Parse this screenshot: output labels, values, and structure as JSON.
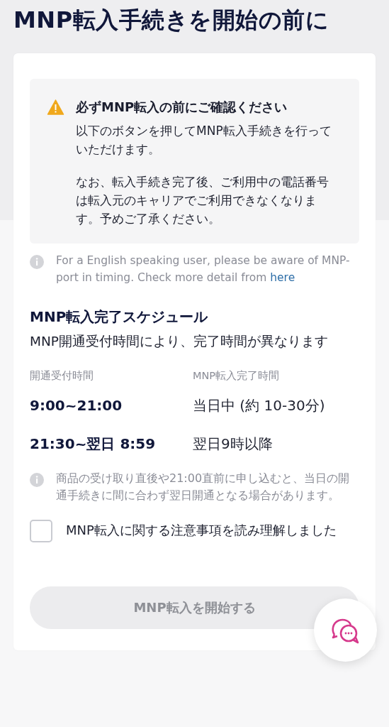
{
  "title": "MNP転入手続きを開始の前に",
  "warning": {
    "heading": "必ずMNP転入の前にご確認ください",
    "paragraphs": [
      "以下のボタンを押してMNP転入手続きを行っていただけます。",
      "なお、転入手続き完了後、ご利用中の電話番号は転入元のキャリアでご利用できなくなります。予めご了承ください。"
    ]
  },
  "english_note": {
    "text": "For a English speaking user, please be aware of MNP-port in timing. Check more detail from ",
    "link": "here"
  },
  "schedule": {
    "heading": "MNP転入完了スケジュール",
    "description": "MNP開通受付時間により、完了時間が異なります",
    "columns": [
      "開通受付時間",
      "MNP転入完了時間"
    ],
    "rows": [
      {
        "reception": "9:00~21:00",
        "completion": "当日中 (約 10-30分)"
      },
      {
        "reception": "21:30~翌日 8:59",
        "completion": "翌日9時以降"
      }
    ]
  },
  "schedule_note": "商品の受け取り直後や21:00直前に申し込むと、当日の開通手続きに間に合わず翌日開通となる場合があります。",
  "agreement": {
    "label": "MNP転入に関する注意事項を読み理解しました",
    "checked": false
  },
  "start_button": {
    "label": "MNP転入を開始する",
    "disabled": true
  }
}
